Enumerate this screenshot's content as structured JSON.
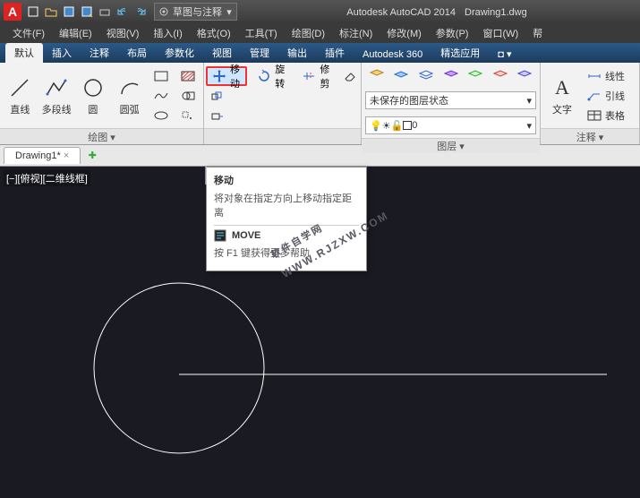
{
  "title_app": "Autodesk AutoCAD 2014",
  "title_file": "Drawing1.dwg",
  "workspace": "草图与注释",
  "menus": [
    "文件(F)",
    "编辑(E)",
    "视图(V)",
    "插入(I)",
    "格式(O)",
    "工具(T)",
    "绘图(D)",
    "标注(N)",
    "修改(M)",
    "参数(P)",
    "窗口(W)",
    "帮"
  ],
  "ribbon_tabs": [
    "默认",
    "插入",
    "注释",
    "布局",
    "参数化",
    "视图",
    "管理",
    "输出",
    "插件",
    "Autodesk 360",
    "精选应用",
    "◘ ▾"
  ],
  "active_tab": 0,
  "draw_panel": {
    "title": "绘图 ▾",
    "buttons": [
      "直线",
      "多段线",
      "圆",
      "圆弧"
    ]
  },
  "modify_panel": {
    "move": "移动",
    "rotate": "旋转",
    "trim": "修剪"
  },
  "layer_panel": {
    "title": "图层 ▾",
    "state": "未保存的图层状态",
    "current": "0"
  },
  "anno_panel": {
    "title": "注释 ▾",
    "big_label": "文字",
    "rows": [
      "线性",
      "引线",
      "表格"
    ]
  },
  "filetab": "Drawing1*",
  "viewport_label": "[−][俯视][二维线框]",
  "tooltip": {
    "title": "移动",
    "desc": "将对象在指定方向上移动指定距离",
    "cmd": "MOVE",
    "help": "按 F1 键获得更多帮助"
  },
  "watermark_top": "软件自学网",
  "watermark_bottom": "WWW.RJZXW.COM"
}
